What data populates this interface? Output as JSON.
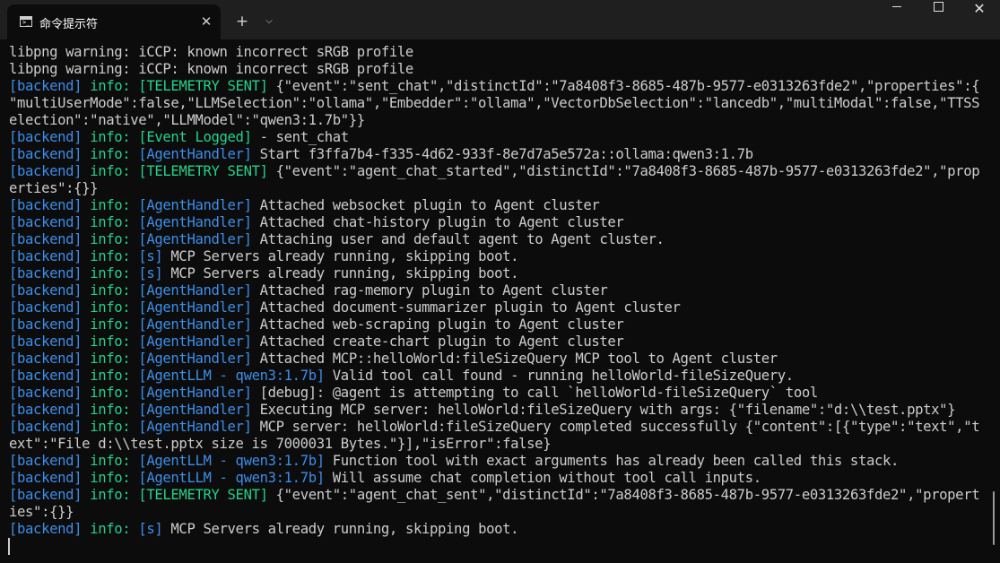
{
  "window": {
    "tab_title": "命令提示符",
    "tab_close": "✕",
    "new_tab": "+",
    "dropdown": "⌵",
    "minimize": "minimize",
    "maximize": "maximize",
    "close": "✕"
  },
  "terminal": {
    "lines": [
      [
        {
          "t": "libpng warning: iCCP: known incorrect sRGB profile",
          "c": "p"
        }
      ],
      [
        {
          "t": "libpng warning: iCCP: known incorrect sRGB profile",
          "c": "p"
        }
      ],
      [
        {
          "t": "[backend]",
          "c": "b"
        },
        {
          "t": " ",
          "c": "p"
        },
        {
          "t": "info:",
          "c": "g"
        },
        {
          "t": " ",
          "c": "p"
        },
        {
          "t": "[TELEMETRY SENT]",
          "c": "g"
        },
        {
          "t": " {\"event\":\"sent_chat\",\"distinctId\":\"7a8408f3-8685-487b-9577-e0313263fde2\",\"properties\":{",
          "c": "p"
        }
      ],
      [
        {
          "t": "\"multiUserMode\":false,\"LLMSelection\":\"ollama\",\"Embedder\":\"ollama\",\"VectorDbSelection\":\"lancedb\",\"multiModal\":false,\"TTSS",
          "c": "p"
        }
      ],
      [
        {
          "t": "election\":\"native\",\"LLMModel\":\"qwen3:1.7b\"}}",
          "c": "p"
        }
      ],
      [
        {
          "t": "[backend]",
          "c": "b"
        },
        {
          "t": " ",
          "c": "p"
        },
        {
          "t": "info:",
          "c": "g"
        },
        {
          "t": " ",
          "c": "p"
        },
        {
          "t": "[Event Logged]",
          "c": "g"
        },
        {
          "t": " - sent_chat",
          "c": "p"
        }
      ],
      [
        {
          "t": "[backend]",
          "c": "b"
        },
        {
          "t": " ",
          "c": "p"
        },
        {
          "t": "info:",
          "c": "g"
        },
        {
          "t": " ",
          "c": "p"
        },
        {
          "t": "[AgentHandler]",
          "c": "b"
        },
        {
          "t": " Start f3ffa7b4-f335-4d62-933f-8e7d7a5e572a::ollama:qwen3:1.7b",
          "c": "p"
        }
      ],
      [
        {
          "t": "[backend]",
          "c": "b"
        },
        {
          "t": " ",
          "c": "p"
        },
        {
          "t": "info:",
          "c": "g"
        },
        {
          "t": " ",
          "c": "p"
        },
        {
          "t": "[TELEMETRY SENT]",
          "c": "g"
        },
        {
          "t": " {\"event\":\"agent_chat_started\",\"distinctId\":\"7a8408f3-8685-487b-9577-e0313263fde2\",\"prop",
          "c": "p"
        }
      ],
      [
        {
          "t": "erties\":{}}",
          "c": "p"
        }
      ],
      [
        {
          "t": "[backend]",
          "c": "b"
        },
        {
          "t": " ",
          "c": "p"
        },
        {
          "t": "info:",
          "c": "g"
        },
        {
          "t": " ",
          "c": "p"
        },
        {
          "t": "[AgentHandler]",
          "c": "b"
        },
        {
          "t": " Attached websocket plugin to Agent cluster",
          "c": "p"
        }
      ],
      [
        {
          "t": "[backend]",
          "c": "b"
        },
        {
          "t": " ",
          "c": "p"
        },
        {
          "t": "info:",
          "c": "g"
        },
        {
          "t": " ",
          "c": "p"
        },
        {
          "t": "[AgentHandler]",
          "c": "b"
        },
        {
          "t": " Attached chat-history plugin to Agent cluster",
          "c": "p"
        }
      ],
      [
        {
          "t": "[backend]",
          "c": "b"
        },
        {
          "t": " ",
          "c": "p"
        },
        {
          "t": "info:",
          "c": "g"
        },
        {
          "t": " ",
          "c": "p"
        },
        {
          "t": "[AgentHandler]",
          "c": "b"
        },
        {
          "t": " Attaching user and default agent to Agent cluster.",
          "c": "p"
        }
      ],
      [
        {
          "t": "[backend]",
          "c": "b"
        },
        {
          "t": " ",
          "c": "p"
        },
        {
          "t": "info:",
          "c": "g"
        },
        {
          "t": " ",
          "c": "p"
        },
        {
          "t": "[s]",
          "c": "b"
        },
        {
          "t": " MCP Servers already running, skipping boot.",
          "c": "p"
        }
      ],
      [
        {
          "t": "[backend]",
          "c": "b"
        },
        {
          "t": " ",
          "c": "p"
        },
        {
          "t": "info:",
          "c": "g"
        },
        {
          "t": " ",
          "c": "p"
        },
        {
          "t": "[s]",
          "c": "b"
        },
        {
          "t": " MCP Servers already running, skipping boot.",
          "c": "p"
        }
      ],
      [
        {
          "t": "[backend]",
          "c": "b"
        },
        {
          "t": " ",
          "c": "p"
        },
        {
          "t": "info:",
          "c": "g"
        },
        {
          "t": " ",
          "c": "p"
        },
        {
          "t": "[AgentHandler]",
          "c": "b"
        },
        {
          "t": " Attached rag-memory plugin to Agent cluster",
          "c": "p"
        }
      ],
      [
        {
          "t": "[backend]",
          "c": "b"
        },
        {
          "t": " ",
          "c": "p"
        },
        {
          "t": "info:",
          "c": "g"
        },
        {
          "t": " ",
          "c": "p"
        },
        {
          "t": "[AgentHandler]",
          "c": "b"
        },
        {
          "t": " Attached document-summarizer plugin to Agent cluster",
          "c": "p"
        }
      ],
      [
        {
          "t": "[backend]",
          "c": "b"
        },
        {
          "t": " ",
          "c": "p"
        },
        {
          "t": "info:",
          "c": "g"
        },
        {
          "t": " ",
          "c": "p"
        },
        {
          "t": "[AgentHandler]",
          "c": "b"
        },
        {
          "t": " Attached web-scraping plugin to Agent cluster",
          "c": "p"
        }
      ],
      [
        {
          "t": "[backend]",
          "c": "b"
        },
        {
          "t": " ",
          "c": "p"
        },
        {
          "t": "info:",
          "c": "g"
        },
        {
          "t": " ",
          "c": "p"
        },
        {
          "t": "[AgentHandler]",
          "c": "b"
        },
        {
          "t": " Attached create-chart plugin to Agent cluster",
          "c": "p"
        }
      ],
      [
        {
          "t": "[backend]",
          "c": "b"
        },
        {
          "t": " ",
          "c": "p"
        },
        {
          "t": "info:",
          "c": "g"
        },
        {
          "t": " ",
          "c": "p"
        },
        {
          "t": "[AgentHandler]",
          "c": "b"
        },
        {
          "t": " Attached MCP::helloWorld:fileSizeQuery MCP tool to Agent cluster",
          "c": "p"
        }
      ],
      [
        {
          "t": "[backend]",
          "c": "b"
        },
        {
          "t": " ",
          "c": "p"
        },
        {
          "t": "info:",
          "c": "g"
        },
        {
          "t": " ",
          "c": "p"
        },
        {
          "t": "[AgentLLM - qwen3:1.7b]",
          "c": "b"
        },
        {
          "t": " Valid tool call found - running helloWorld-fileSizeQuery.",
          "c": "p"
        }
      ],
      [
        {
          "t": "[backend]",
          "c": "b"
        },
        {
          "t": " ",
          "c": "p"
        },
        {
          "t": "info:",
          "c": "g"
        },
        {
          "t": " ",
          "c": "p"
        },
        {
          "t": "[AgentHandler]",
          "c": "b"
        },
        {
          "t": " [debug]: @agent is attempting to call `helloWorld-fileSizeQuery` tool",
          "c": "p"
        }
      ],
      [
        {
          "t": "[backend]",
          "c": "b"
        },
        {
          "t": " ",
          "c": "p"
        },
        {
          "t": "info:",
          "c": "g"
        },
        {
          "t": " ",
          "c": "p"
        },
        {
          "t": "[AgentHandler]",
          "c": "b"
        },
        {
          "t": " Executing MCP server: helloWorld:fileSizeQuery with args: {\"filename\":\"d:\\\\test.pptx\"}",
          "c": "p"
        }
      ],
      [
        {
          "t": "[backend]",
          "c": "b"
        },
        {
          "t": " ",
          "c": "p"
        },
        {
          "t": "info:",
          "c": "g"
        },
        {
          "t": " ",
          "c": "p"
        },
        {
          "t": "[AgentHandler]",
          "c": "b"
        },
        {
          "t": " MCP server: helloWorld:fileSizeQuery completed successfully {\"content\":[{\"type\":\"text\",\"t",
          "c": "p"
        }
      ],
      [
        {
          "t": "ext\":\"File d:\\\\test.pptx size is 7000031 Bytes.\"}],\"isError\":false}",
          "c": "p"
        }
      ],
      [
        {
          "t": "[backend]",
          "c": "b"
        },
        {
          "t": " ",
          "c": "p"
        },
        {
          "t": "info:",
          "c": "g"
        },
        {
          "t": " ",
          "c": "p"
        },
        {
          "t": "[AgentLLM - qwen3:1.7b]",
          "c": "b"
        },
        {
          "t": " Function tool with exact arguments has already been called this stack.",
          "c": "p"
        }
      ],
      [
        {
          "t": "[backend]",
          "c": "b"
        },
        {
          "t": " ",
          "c": "p"
        },
        {
          "t": "info:",
          "c": "g"
        },
        {
          "t": " ",
          "c": "p"
        },
        {
          "t": "[AgentLLM - qwen3:1.7b]",
          "c": "b"
        },
        {
          "t": " Will assume chat completion without tool call inputs.",
          "c": "p"
        }
      ],
      [
        {
          "t": "[backend]",
          "c": "b"
        },
        {
          "t": " ",
          "c": "p"
        },
        {
          "t": "info:",
          "c": "g"
        },
        {
          "t": " ",
          "c": "p"
        },
        {
          "t": "[TELEMETRY SENT]",
          "c": "g"
        },
        {
          "t": " {\"event\":\"agent_chat_sent\",\"distinctId\":\"7a8408f3-8685-487b-9577-e0313263fde2\",\"propert",
          "c": "p"
        }
      ],
      [
        {
          "t": "ies\":{}}",
          "c": "p"
        }
      ],
      [
        {
          "t": "[backend]",
          "c": "b"
        },
        {
          "t": " ",
          "c": "p"
        },
        {
          "t": "info:",
          "c": "g"
        },
        {
          "t": " ",
          "c": "p"
        },
        {
          "t": "[s]",
          "c": "b"
        },
        {
          "t": " MCP Servers already running, skipping boot.",
          "c": "p"
        }
      ]
    ]
  },
  "colors": {
    "background": "#0c0c0c",
    "titlebar": "#1f1f1f",
    "plain_text": "#cccccc",
    "blue_tag": "#3b8eea",
    "green_tag": "#23d18b"
  },
  "icons": {
    "tab": "terminal-icon",
    "close": "close-icon",
    "add": "plus-icon",
    "dropdown": "chevron-down-icon"
  }
}
